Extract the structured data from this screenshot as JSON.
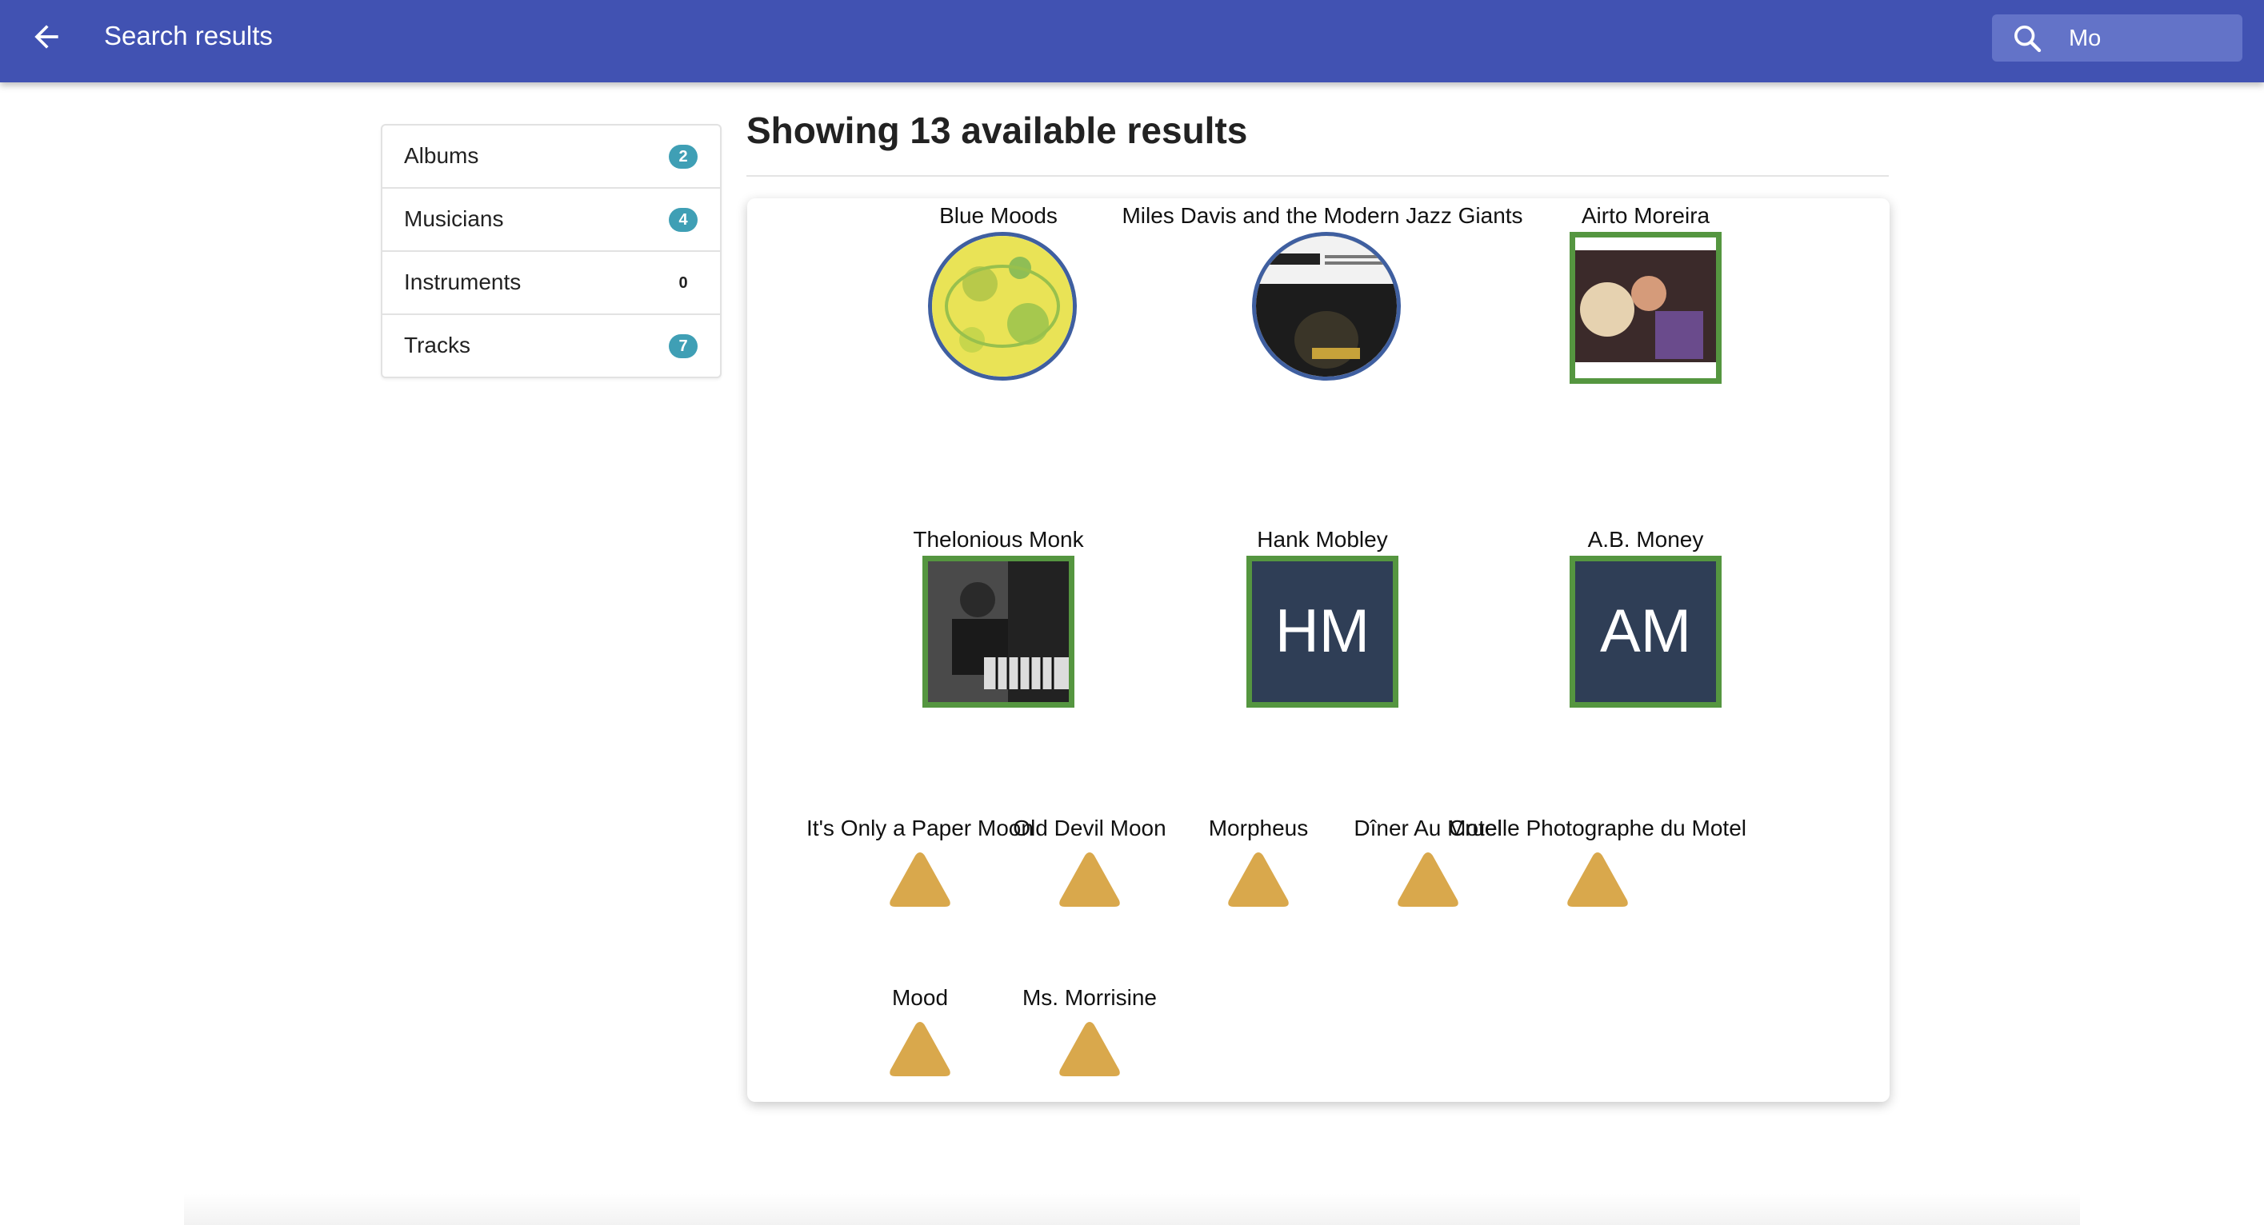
{
  "appbar": {
    "title": "Search results",
    "search_value": "Mo"
  },
  "sidebar": {
    "items": [
      {
        "label": "Albums",
        "count": "2"
      },
      {
        "label": "Musicians",
        "count": "4"
      },
      {
        "label": "Instruments",
        "count": "0"
      },
      {
        "label": "Tracks",
        "count": "7"
      }
    ]
  },
  "main": {
    "heading": "Showing 13 available results",
    "albums": [
      {
        "title": "Blue Moods"
      },
      {
        "title": "Miles Davis and the Modern Jazz Giants"
      }
    ],
    "musicians": [
      {
        "name": "Airto Moreira"
      },
      {
        "name": "Thelonious Monk"
      },
      {
        "name": "Hank Mobley",
        "initials": "HM"
      },
      {
        "name": "A.B. Money",
        "initials": "AM"
      }
    ],
    "tracks": [
      {
        "title": "It's Only a Paper Moon"
      },
      {
        "title": "Old Devil Moon"
      },
      {
        "title": "Morpheus"
      },
      {
        "title": "Dîner Au Motel"
      },
      {
        "title": "Cruelle Photographe du Motel"
      },
      {
        "title": "Mood"
      },
      {
        "title": "Ms. Morrisine"
      }
    ]
  },
  "colors": {
    "appbar": "#4152b2",
    "badge": "#3f9fb5",
    "musician_border": "#559640",
    "album_border": "#3f5fa0",
    "track_icon": "#d9a84c"
  }
}
